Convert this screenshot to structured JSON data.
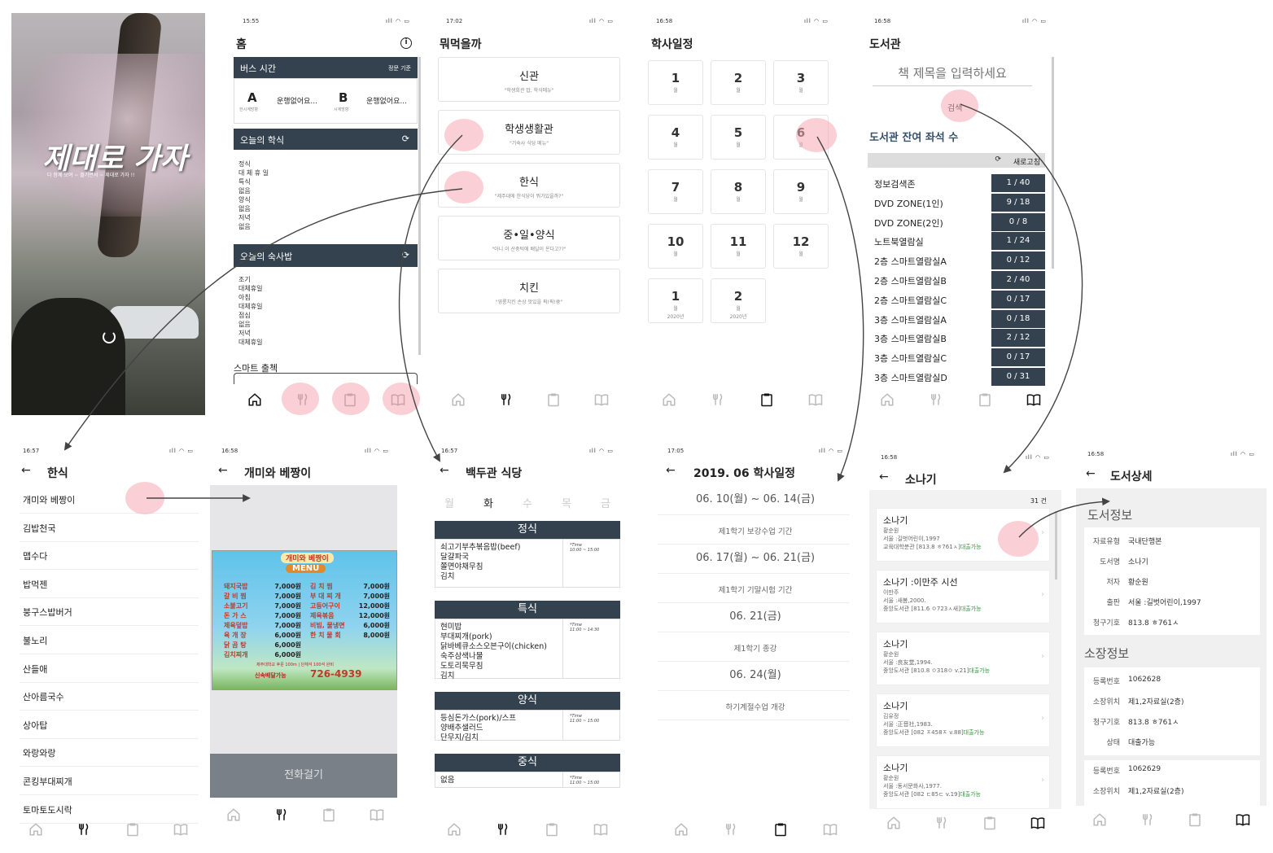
{
  "splash": {
    "title": "제대로 가자",
    "subtitle": "다 함께 모여 ~ 즐기면서 ~ 제대로 가자 !!"
  },
  "home": {
    "time": "15:55",
    "title": "홈",
    "bus": {
      "header": "버스 시간",
      "note": "정문 기준",
      "a_label": "A",
      "a_sub": "한시계방향",
      "a_status": "운행없어요...",
      "b_label": "B",
      "b_sub": "시계방향",
      "b_status": "운행없어요..."
    },
    "meal": {
      "header": "오늘의 학식",
      "lines": [
        "정식",
        "대 체 휴 일",
        "특식",
        "없음",
        "양식",
        "없음",
        "저녁",
        "없음"
      ]
    },
    "dorm": {
      "header": "오늘의 숙사밥",
      "lines": [
        "조기",
        "대체휴일",
        "아침",
        "대체휴일",
        "점심",
        "없음",
        "저녁",
        "대체휴일"
      ]
    },
    "smart": "스마트 출첵"
  },
  "eat": {
    "time": "17:02",
    "title": "뭐먹을까",
    "cards": [
      {
        "title": "신관",
        "sub": "\"학생회관 밥, 학식메뉴\""
      },
      {
        "title": "학생생활관",
        "sub": "\"기숙사 식당 메뉴\""
      },
      {
        "title": "한식",
        "sub": "\"제주대에 한식당이 뭐가있을까?\""
      },
      {
        "title": "중•일•양식",
        "sub": "\"아니 이 산중턱에 배달이 온다고??\""
      },
      {
        "title": "치킨",
        "sub": "\"영롱치킨 손상 맛있을 픽!픽!쓩\""
      }
    ]
  },
  "schedule": {
    "time": "16:58",
    "title": "학사일정",
    "month_label": "월",
    "months": [
      {
        "n": "1",
        "y": ""
      },
      {
        "n": "2",
        "y": ""
      },
      {
        "n": "3",
        "y": ""
      },
      {
        "n": "4",
        "y": ""
      },
      {
        "n": "5",
        "y": ""
      },
      {
        "n": "6",
        "y": ""
      },
      {
        "n": "7",
        "y": ""
      },
      {
        "n": "8",
        "y": ""
      },
      {
        "n": "9",
        "y": ""
      },
      {
        "n": "10",
        "y": ""
      },
      {
        "n": "11",
        "y": ""
      },
      {
        "n": "12",
        "y": ""
      },
      {
        "n": "1",
        "y": "2020년"
      },
      {
        "n": "2",
        "y": "2020년"
      }
    ]
  },
  "library": {
    "time": "16:58",
    "title": "도서관",
    "placeholder": "책 제목을 입력하세요",
    "search": "검색",
    "seats_title": "도서관 잔여 좌석 수",
    "refresh": "새로고침",
    "seats": [
      {
        "name": "정보검색존",
        "val": "1 / 40"
      },
      {
        "name": "DVD ZONE(1인)",
        "val": "9 / 18"
      },
      {
        "name": "DVD ZONE(2인)",
        "val": "0 / 8"
      },
      {
        "name": "노트북열람실",
        "val": "1 / 24"
      },
      {
        "name": "2층 스마트열람실A",
        "val": "0 / 12"
      },
      {
        "name": "2층 스마트열람실B",
        "val": "2 / 40"
      },
      {
        "name": "2층 스마트열람실C",
        "val": "0 / 17"
      },
      {
        "name": "3층 스마트열람실A",
        "val": "0 / 18"
      },
      {
        "name": "3층 스마트열람실B",
        "val": "2 / 12"
      },
      {
        "name": "3층 스마트열람실C",
        "val": "0 / 17"
      },
      {
        "name": "3층 스마트열람실D",
        "val": "0 / 31"
      }
    ]
  },
  "korean": {
    "time": "16:57",
    "title": "한식",
    "items": [
      "개미와 베짱이",
      "김밥천국",
      "맵수다",
      "밥먹젠",
      "붕구스밥버거",
      "불노리",
      "산들애",
      "산아름국수",
      "상아탑",
      "와랑와랑",
      "콘킹부대찌개",
      "토마토도시락"
    ]
  },
  "ant": {
    "time": "16:58",
    "title": "개미와 베짱이",
    "call": "전화걸기",
    "menu": {
      "brand": "개미와 베짱이",
      "menu_word": "MENU",
      "left": [
        {
          "n": "돼지국밥",
          "p": "7,000원"
        },
        {
          "n": "갈 비 찜",
          "p": "7,000원"
        },
        {
          "n": "소불고기",
          "p": "7,000원"
        },
        {
          "n": "돈 가 스",
          "p": "7,000원"
        },
        {
          "n": "제육덮밥",
          "p": "7,000원"
        },
        {
          "n": "육 개 장",
          "p": "6,000원"
        },
        {
          "n": "닭 곰 탕",
          "p": "6,000원"
        },
        {
          "n": "김치찌개",
          "p": "6,000원"
        }
      ],
      "right": [
        {
          "n": "김 치 찜",
          "p": "7,000원"
        },
        {
          "n": "부 대 찌 개",
          "p": "7,000원"
        },
        {
          "n": "고등어구이",
          "p": "12,000원"
        },
        {
          "n": "제육볶음",
          "p": "12,000원"
        },
        {
          "n": "비빔, 물냉면",
          "p": "6,000원"
        },
        {
          "n": "한 치 물 회",
          "p": "8,000원"
        }
      ],
      "footer": "제주대학교 후문 100m | 단체석 100석 완비",
      "phone_label": "신속배달가능",
      "phone": "726-4939"
    }
  },
  "baekdu": {
    "time": "16:57",
    "title": "백두관 식당",
    "days": [
      "월",
      "화",
      "수",
      "목",
      "금"
    ],
    "active_day": 1,
    "sections": [
      {
        "name": "정식",
        "items": [
          "쇠고기부추볶음밥(beef)",
          "달걀파국",
          "쫄면야채무침",
          "김치"
        ],
        "time_label": "*Time",
        "time": "10:00 ~ 15:00"
      },
      {
        "name": "특식",
        "items": [
          "현미밥",
          "부대찌개(pork)",
          "닭바베큐소스오븐구이(chicken)",
          "숙주삼색나물",
          "도토리묵무침",
          "김치"
        ],
        "time_label": "*Time",
        "time": "11:00 ~ 14:30"
      },
      {
        "name": "양식",
        "items": [
          "등심돈가스(pork)/스프",
          "양배추샐러드",
          "단무지/김치"
        ],
        "time_label": "*Time",
        "time": "11:00 ~ 15:00"
      },
      {
        "name": "중식",
        "items": [
          "없음"
        ],
        "time_label": "*Time",
        "time": "11:00 ~ 15:00"
      }
    ]
  },
  "june": {
    "time": "17:05",
    "title": "2019. 06 학사일정",
    "events": [
      {
        "date": "06. 10(월) ~ 06. 14(금)",
        "desc": "제1학기 보강수업 기간"
      },
      {
        "date": "06. 17(월) ~ 06. 21(금)",
        "desc": "제1학기 기말시험 기간"
      },
      {
        "date": "06. 21(금)",
        "desc": "제1학기 종강"
      },
      {
        "date": "06. 24(월)",
        "desc": "하기계절수업 개강"
      }
    ]
  },
  "sonagi": {
    "time": "16:58",
    "title": "소나기",
    "count": "31 건",
    "avail": "대출가능",
    "books": [
      {
        "t": "소나기",
        "a": "황순원",
        "p": "서울 :길벗어린이,1997",
        "l": "교육대학분관 [813.8 ㅎ761ㅅ]"
      },
      {
        "t": "소나기 :이만주 시선",
        "a": "이만주",
        "p": "서울 :새봄,2000.",
        "l": "중앙도서관 [811.6 ㅇ723ㅅ새]"
      },
      {
        "t": "소나기",
        "a": "황순원",
        "p": "서울 :良友堂,1994.",
        "l": "중앙도서관 [810.8 ㅇ318ㅇ v.21]"
      },
      {
        "t": "소나기",
        "a": "김유정",
        "p": "서울 :正音社,1983.",
        "l": "중앙도서관 [082 ㅈ458ㅈ v.88]"
      },
      {
        "t": "소나기",
        "a": "황순원",
        "p": "서울 :동서문화사,1977.",
        "l": "중앙도서관 [082 ㄷ85ㄷ v.19]"
      }
    ]
  },
  "detail": {
    "time": "16:58",
    "title": "도서상세",
    "info_title": "도서정보",
    "info": [
      {
        "k": "자료유형",
        "v": "국내단행본"
      },
      {
        "k": "도서명",
        "v": "소나기"
      },
      {
        "k": "저자",
        "v": "황순원"
      },
      {
        "k": "출판",
        "v": "서울 :길벗어린이,1997"
      },
      {
        "k": "청구기호",
        "v": "813.8 ㅎ761ㅅ"
      }
    ],
    "hold_title": "소장정보",
    "hold1": [
      {
        "k": "등록번호",
        "v": "1062628"
      },
      {
        "k": "소장위치",
        "v": "제1,2자료실(2층)"
      },
      {
        "k": "청구기호",
        "v": "813.8 ㅎ761ㅅ"
      },
      {
        "k": "상태",
        "v": "대출가능"
      }
    ],
    "hold2": [
      {
        "k": "등록번호",
        "v": "1062629"
      },
      {
        "k": "소장위치",
        "v": "제1,2자료실(2층)"
      }
    ]
  },
  "status_icons": "ıll ◠ ▭",
  "icons": [
    "home-icon",
    "utensils-icon",
    "clipboard-icon",
    "book-icon",
    "back-arrow-icon",
    "info-icon",
    "refresh-icon",
    "chevron-right-icon"
  ]
}
